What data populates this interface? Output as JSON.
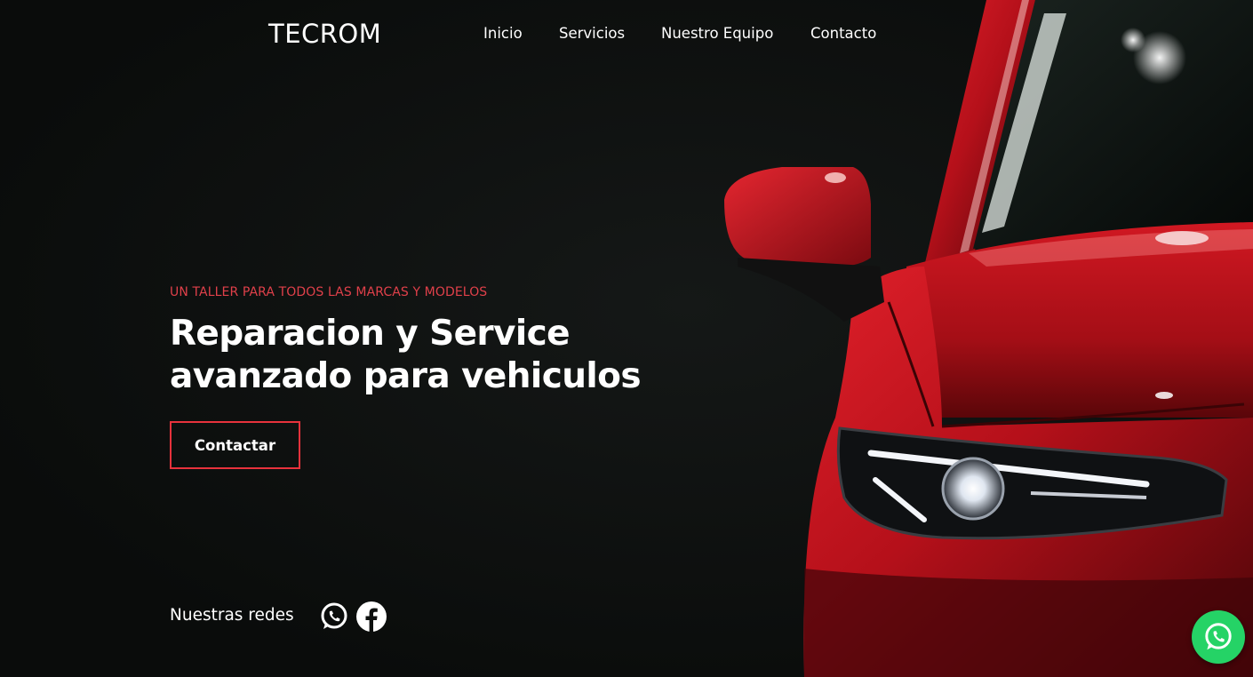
{
  "brand": {
    "name": "TECROM"
  },
  "nav": {
    "items": [
      {
        "label": "Inicio"
      },
      {
        "label": "Servicios"
      },
      {
        "label": "Nuestro Equipo"
      },
      {
        "label": "Contacto"
      }
    ]
  },
  "hero": {
    "eyebrow": "UN TALLER PARA TODOS LAS MARCAS Y MODELOS",
    "headline_line1": "Reparacion y Service",
    "headline_line2": "avanzado para vehiculos",
    "cta_label": "Contactar"
  },
  "social": {
    "label": "Nuestras redes",
    "icons": [
      "whatsapp-icon",
      "facebook-icon"
    ]
  },
  "floating": {
    "icon": "whatsapp-icon"
  },
  "colors": {
    "background": "#0d0f0e",
    "accent": "#e8323c",
    "eyebrow": "#e0404a",
    "whatsapp_green": "#25d366",
    "car_red": "#c4121b"
  }
}
